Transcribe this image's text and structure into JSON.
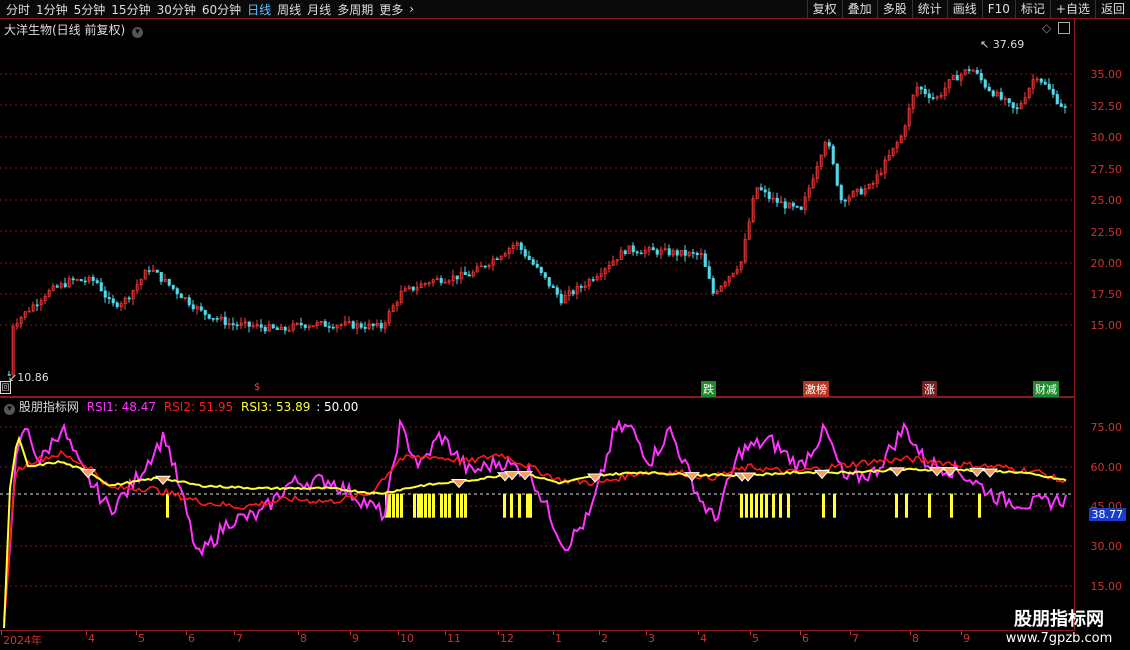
{
  "periods": [
    "分时",
    "1分钟",
    "5分钟",
    "15分钟",
    "30分钟",
    "60分钟",
    "日线",
    "周线",
    "月线",
    "多周期",
    "更多"
  ],
  "active_period": "日线",
  "tools": [
    "复权",
    "叠加",
    "多股",
    "统计",
    "画线",
    "F10",
    "标记",
    "+自选",
    "返回"
  ],
  "main": {
    "title": "大洋生物(日线 前复权)",
    "max_label": "37.69",
    "min_label": "10.86",
    "price_ticks": [
      "35.00",
      "32.50",
      "30.00",
      "27.50",
      "25.00",
      "22.50",
      "20.00",
      "17.50",
      "15.00"
    ],
    "tags": [
      {
        "text": "跌",
        "color": "#1f8a2a"
      },
      {
        "text": "激榜",
        "color": "#c0392b"
      },
      {
        "text": "涨",
        "color": "#c0392b"
      },
      {
        "text": "财减",
        "color": "#1f8a2a"
      }
    ]
  },
  "indicator": {
    "name": "股朋指标网",
    "rsi1_label": "RSI1: 48.47",
    "rsi2_label": "RSI2: 51.95",
    "rsi3_label": "RSI3: 53.89",
    "level_label": ": 50.00",
    "ticks": [
      "75.00",
      "60.00",
      "45.00",
      "30.00",
      "15.00"
    ],
    "current_value": "38.77"
  },
  "date_labels": [
    "2024年",
    "4",
    "5",
    "6",
    "7",
    "8",
    "9",
    "10",
    "11",
    "12",
    "1",
    "2",
    "3",
    "4",
    "5",
    "6",
    "7",
    "8",
    "9"
  ],
  "watermark": {
    "line1": "股朋指标网",
    "line2": "www.7gpzb.com"
  },
  "colors": {
    "up": "#ff3b3b",
    "down": "#54d8e8",
    "rsi1": "#ff33ff",
    "rsi2": "#ff1a1a",
    "rsi3": "#ffff33",
    "grid": "#7a1a1a"
  }
}
